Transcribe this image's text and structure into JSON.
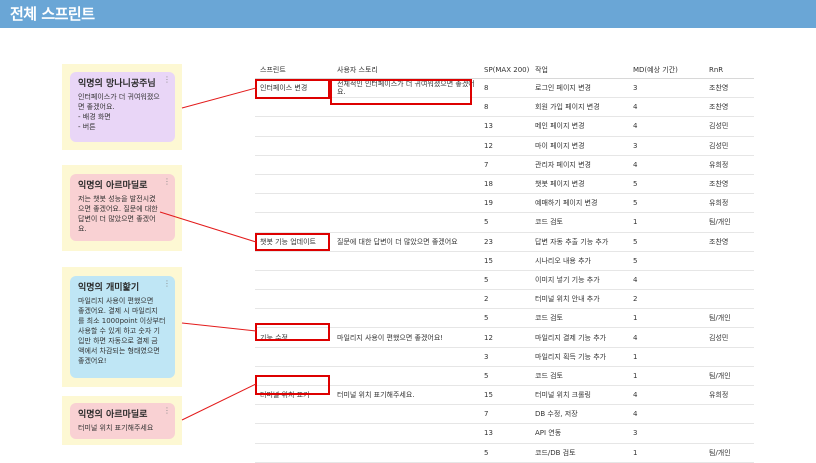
{
  "page": {
    "title": "전체 스프린트"
  },
  "notes": [
    {
      "title": "익명의 망나니공주님",
      "body": "인터페이스가 더 귀여워졌으\n면 좋겠어요.\n- 배경 화면\n- 버튼",
      "color": "#e9d6f7"
    },
    {
      "title": "익명의 아르마딜로",
      "body": "저는 챗봇 성능을 발전시켰\n으면 좋겠어요. 질문에 대한\n답변이 더 많았으면 좋겠어\n요.",
      "color": "#f9d1d3"
    },
    {
      "title": "익명의 개미핥기",
      "body": "마일리지 사용이 편했으면\n좋겠어요. 결제 시 마일리지\n를 최소 1000point 이상부터\n사용할 수 있게 하고 숫자 기\n입만 하면 자동으로 결제 금\n액에서 차감되는 형태였으면\n좋겠어요!",
      "color": "#bfe6f5"
    },
    {
      "title": "익명의 아르마딜로",
      "body": "터미널 위치 표기해주세요",
      "color": "#f9d1d3"
    }
  ],
  "table": {
    "headers": [
      "스프린트",
      "사용자 스토리",
      "SP(MAX 200)",
      "작업",
      "MD(예상 기간)",
      "RnR"
    ],
    "rows": [
      [
        "인터페이스 변경",
        "전체적인 인터페이스가 더 귀여워졌으면 좋겠어요.",
        "8",
        "로그인 페이지 변경",
        "3",
        "조찬영"
      ],
      [
        "",
        "",
        "8",
        "회원 가입 페이지 변경",
        "4",
        "조찬영"
      ],
      [
        "",
        "",
        "13",
        "메인 페이지 변경",
        "4",
        "김성민"
      ],
      [
        "",
        "",
        "12",
        "마이 페이지 변경",
        "3",
        "김성민"
      ],
      [
        "",
        "",
        "7",
        "관리자 페이지 변경",
        "4",
        "유희정"
      ],
      [
        "",
        "",
        "18",
        "챗봇 페이지 변경",
        "5",
        "조찬영"
      ],
      [
        "",
        "",
        "19",
        "예매하기 페이지 변경",
        "5",
        "유희정"
      ],
      [
        "",
        "",
        "5",
        "코드 검토",
        "1",
        "팀/개인"
      ],
      [
        "챗봇 기능 업데이트",
        "질문에 대한 답변이 더 많았으면 좋겠어요",
        "23",
        "답변 자동 추출 기능 추가",
        "5",
        "조찬영"
      ],
      [
        "",
        "",
        "15",
        "시나리오 내용 추가",
        "5",
        ""
      ],
      [
        "",
        "",
        "5",
        "이미지 넣기 기능 추가",
        "4",
        ""
      ],
      [
        "",
        "",
        "2",
        "터미널 위치 안내 추가",
        "2",
        ""
      ],
      [
        "",
        "",
        "5",
        "코드 검토",
        "1",
        "팀/개인"
      ],
      [
        "기능 수정",
        "마일리지 사용이 편했으면 좋겠어요!",
        "12",
        "마일리지 결제 기능 추가",
        "4",
        "김성민"
      ],
      [
        "",
        "",
        "3",
        "마일리지 획득 기능 추가",
        "1",
        ""
      ],
      [
        "",
        "",
        "5",
        "코드 검토",
        "1",
        "팀/개인"
      ],
      [
        "터미널 위치 표기",
        "터미널 위치 표기해주세요.",
        "15",
        "터미널 위치 크롤링",
        "4",
        "유희정"
      ],
      [
        "",
        "",
        "7",
        "DB 수정, 저장",
        "4",
        ""
      ],
      [
        "",
        "",
        "13",
        "API 연동",
        "3",
        ""
      ],
      [
        "",
        "",
        "5",
        "코드/DB 검토",
        "1",
        "팀/개인"
      ]
    ]
  },
  "menu_glyph": "⋮"
}
